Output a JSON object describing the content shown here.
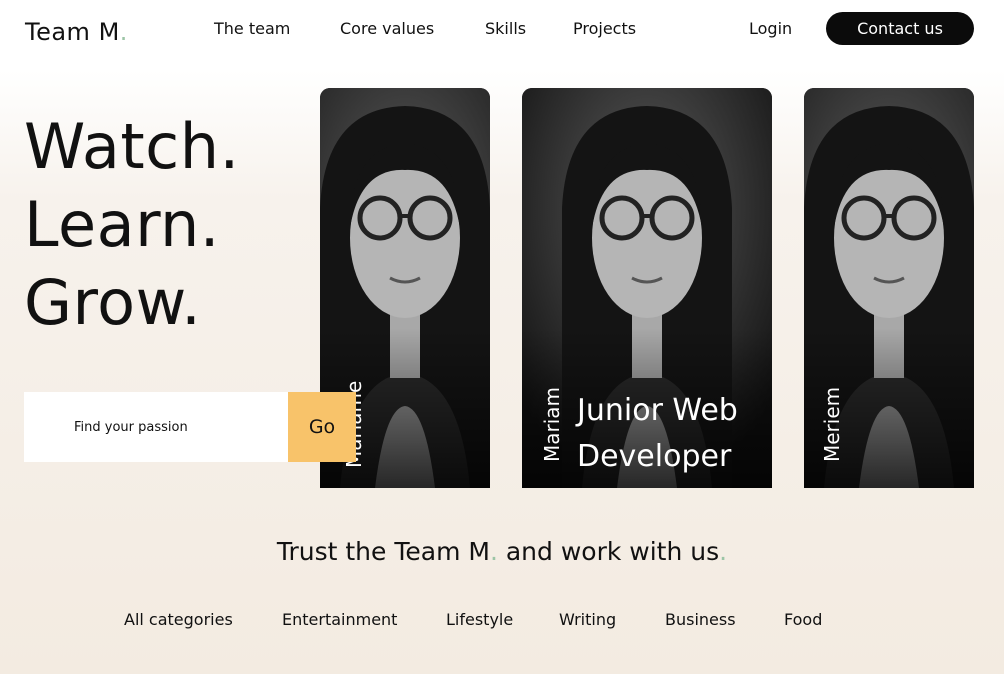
{
  "header": {
    "logo_text": "Team M",
    "logo_dot": ".",
    "nav": [
      "The team",
      "Core values",
      "Skills",
      "Projects"
    ],
    "login_label": "Login",
    "contact_label": "Contact us"
  },
  "hero": {
    "lines": [
      "Watch.",
      "Learn.",
      "Grow."
    ],
    "search_placeholder": "Find your passion",
    "go_label": "Go"
  },
  "cards": [
    {
      "name": "Mariame",
      "role_line1": "",
      "role_line2": ""
    },
    {
      "name": "Mariam",
      "role_line1": "Junior Web",
      "role_line2": "Developer"
    },
    {
      "name": "Meriem",
      "role_line1": "",
      "role_line2": ""
    }
  ],
  "trust": {
    "prefix": "Trust the Team M",
    "dot1": ".",
    "suffix": " and work with us",
    "dot2": "."
  },
  "categories": [
    "All categories",
    "Entertainment",
    "Lifestyle",
    "Writing",
    "Business",
    "Food"
  ],
  "colors": {
    "accent_yellow": "#f8c36a",
    "accent_green": "#9cc5a6",
    "dark": "#0b0b0b"
  }
}
